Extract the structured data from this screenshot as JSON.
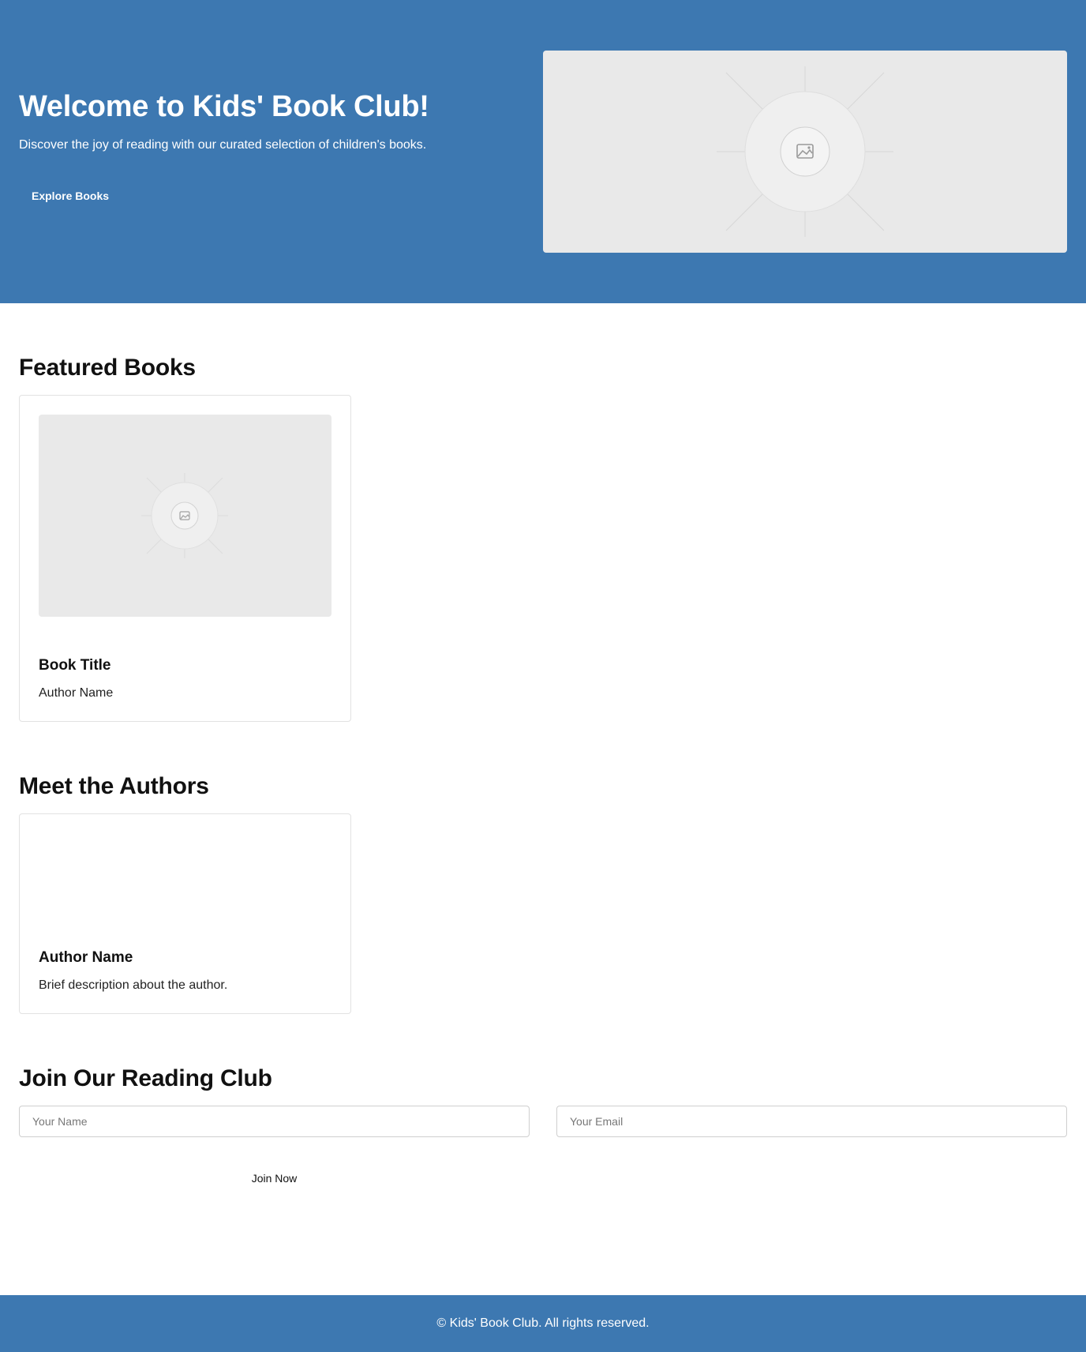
{
  "hero": {
    "title": "Welcome to Kids' Book Club!",
    "subtitle": "Discover the joy of reading with our curated selection of children's books.",
    "cta_label": "Explore Books",
    "image_icon": "image-placeholder-icon"
  },
  "featured": {
    "heading": "Featured Books",
    "books": [
      {
        "title": "Book Title",
        "author": "Author Name",
        "image_icon": "image-placeholder-icon"
      }
    ]
  },
  "authors": {
    "heading": "Meet the Authors",
    "items": [
      {
        "name": "Author Name",
        "description": "Brief description about the author."
      }
    ]
  },
  "join": {
    "heading": "Join Our Reading Club",
    "name_placeholder": "Your Name",
    "email_placeholder": "Your Email",
    "button_label": "Join Now"
  },
  "footer": {
    "text": "© Kids' Book Club. All rights reserved."
  },
  "colors": {
    "brand": "#3d78b1",
    "placeholder_bg": "#e9e9e9"
  }
}
